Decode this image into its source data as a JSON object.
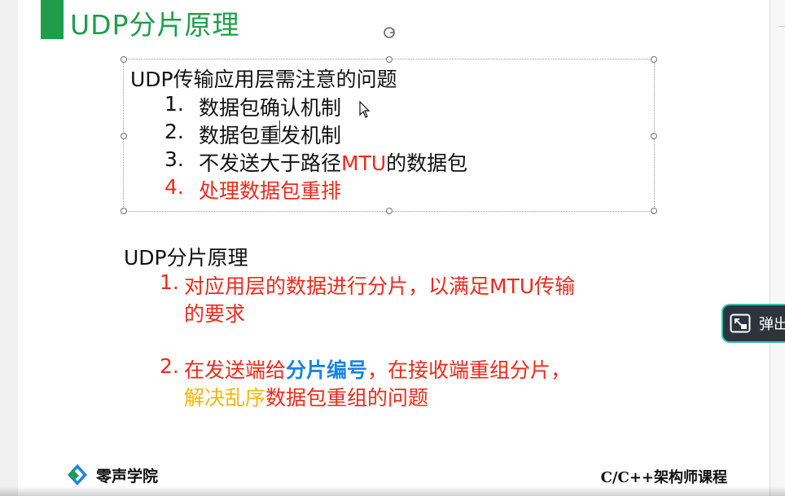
{
  "slide": {
    "title": "UDP分片原理",
    "box1": {
      "heading": "UDP传输应用层需注意的问题",
      "items": [
        {
          "num": "1.",
          "text": "数据包确认机制"
        },
        {
          "num": "2.",
          "text": "数据包重发机制"
        },
        {
          "num": "3.",
          "text_before": "不发送大于路径",
          "text_highlight": "MTU",
          "text_after": "的数据包"
        },
        {
          "num": "4.",
          "text": "处理数据包重排"
        }
      ]
    },
    "box2": {
      "heading": "UDP分片原理",
      "item1_num": "1.",
      "item1_line1": "对应用层的数据进行分片，以满足MTU传输",
      "item1_line2": "的要求",
      "item2_num": "2.",
      "item2_line1_pre": "在发送端给",
      "item2_line1_blue": "分片编号",
      "item2_line1_post": "，在接收端重组分片，",
      "item2_line2_yellow": "解决乱序",
      "item2_line2_rest": "数据包重组的问题"
    },
    "footer": {
      "left": "零声学院",
      "right": "C/C++架构师课程"
    }
  },
  "popup": {
    "label": "弹出",
    "icon": "popout-icon"
  },
  "colors": {
    "title_green": "#1e9e4b",
    "red": "#ee2a1b",
    "blue": "#1a84e0",
    "yellow": "#f2b705",
    "popup_bg": "#2d343e",
    "popup_border": "#36c0a8"
  }
}
